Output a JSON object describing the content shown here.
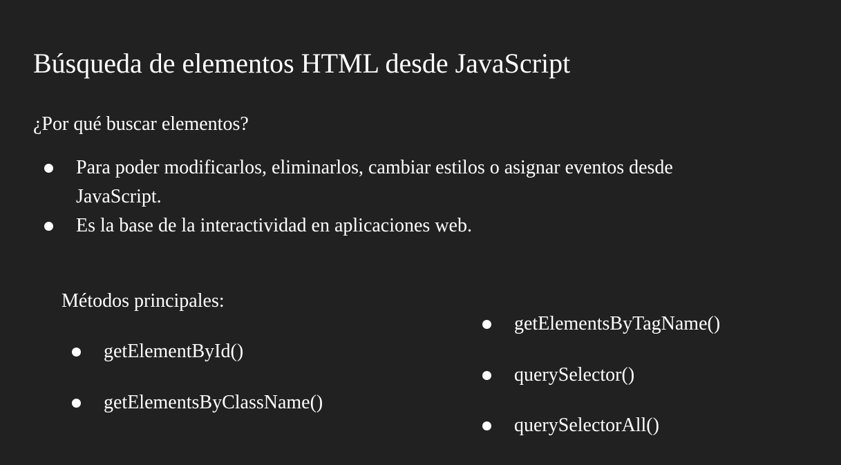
{
  "slide": {
    "title": "Búsqueda de elementos HTML desde JavaScript",
    "subtitle": "¿Por qué buscar elementos?",
    "bullets": [
      {
        "line1": "Para poder modificarlos, eliminarlos, cambiar estilos o asignar eventos desde",
        "line2": "JavaScript."
      },
      {
        "line1": "Es la base de la interactividad en aplicaciones web."
      }
    ],
    "methods_heading": "Métodos principales:",
    "methods_left": [
      "getElementById()",
      "getElementsByClassName()"
    ],
    "methods_right": [
      "getElementsByTagName()",
      "querySelector()",
      "querySelectorAll()"
    ]
  },
  "colors": {
    "background": "#212121",
    "text": "#ffffff"
  }
}
